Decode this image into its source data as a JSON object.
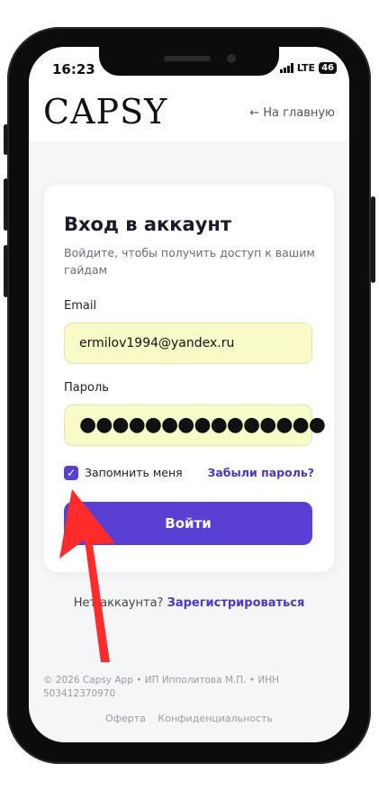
{
  "status": {
    "time": "16:23",
    "network": "LTE",
    "battery": "46"
  },
  "header": {
    "logo": "CAPSY",
    "home_link": "← На главную"
  },
  "login": {
    "title": "Вход в аккаунт",
    "subtitle": "Войдите, чтобы получить доступ к вашим гайдам",
    "email_label": "Email",
    "email_value": "ermilov1994@yandex.ru",
    "password_label": "Пароль",
    "password_value": "●●●●●●●●●●●●●●●",
    "remember_label": "Запомнить меня",
    "remember_checked": true,
    "forgot_link": "Забыли пароль?",
    "submit_label": "Войти"
  },
  "register": {
    "prompt": "Нет аккаунта?",
    "link": "Зарегистрироваться"
  },
  "footer": {
    "legal": "© 2026 Capsy App • ИП Ипполитова М.П. • ИНН 503412370970",
    "links": [
      "Оферта",
      "Конфиденциальность"
    ]
  },
  "colors": {
    "accent": "#5b3fd4",
    "input_bg": "#f8fbc7",
    "arrow": "#ff2a2a"
  }
}
